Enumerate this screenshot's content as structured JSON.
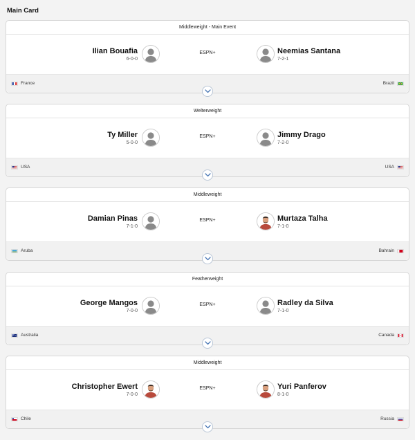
{
  "section_title": "Main Card",
  "fights": [
    {
      "weight_class": "Middleweight - Main Event",
      "broadcast": "ESPN+",
      "red": {
        "name": "Ilian Bouafia",
        "record": "6-0-0",
        "country": "France",
        "flag": "france",
        "photo": "placeholder"
      },
      "blue": {
        "name": "Neemias Santana",
        "record": "7-2-1",
        "country": "Brazil",
        "flag": "brazil",
        "photo": "placeholder"
      }
    },
    {
      "weight_class": "Welterweight",
      "broadcast": "ESPN+",
      "red": {
        "name": "Ty Miller",
        "record": "5-0-0",
        "country": "USA",
        "flag": "usa",
        "photo": "placeholder"
      },
      "blue": {
        "name": "Jimmy Drago",
        "record": "7-2-0",
        "country": "USA",
        "flag": "usa",
        "photo": "placeholder"
      }
    },
    {
      "weight_class": "Middleweight",
      "broadcast": "ESPN+",
      "red": {
        "name": "Damian Pinas",
        "record": "7-1-0",
        "country": "Aruba",
        "flag": "aruba",
        "photo": "placeholder"
      },
      "blue": {
        "name": "Murtaza Talha",
        "record": "7-1-0",
        "country": "Bahrain",
        "flag": "bahrain",
        "photo": "headshot"
      }
    },
    {
      "weight_class": "Featherweight",
      "broadcast": "ESPN+",
      "red": {
        "name": "George Mangos",
        "record": "7-0-0",
        "country": "Australia",
        "flag": "australia",
        "photo": "placeholder"
      },
      "blue": {
        "name": "Radley da Silva",
        "record": "7-1-0",
        "country": "Canada",
        "flag": "canada",
        "photo": "placeholder"
      }
    },
    {
      "weight_class": "Middleweight",
      "broadcast": "ESPN+",
      "red": {
        "name": "Christopher Ewert",
        "record": "7-0-0",
        "country": "Chile",
        "flag": "chile",
        "photo": "headshot"
      },
      "blue": {
        "name": "Yuri Panferov",
        "record": "8-1-0",
        "country": "Russia",
        "flag": "russia",
        "photo": "headshot"
      }
    }
  ],
  "colors": {
    "card_border": "#d6d6d6",
    "footer_bg": "#f1f1f1",
    "expand_chevron": "#4a78b5",
    "placeholder_silhouette": "#8a8a8a"
  },
  "icons": {
    "expand": "chevron-down-icon",
    "placeholder": "user-silhouette-icon"
  }
}
